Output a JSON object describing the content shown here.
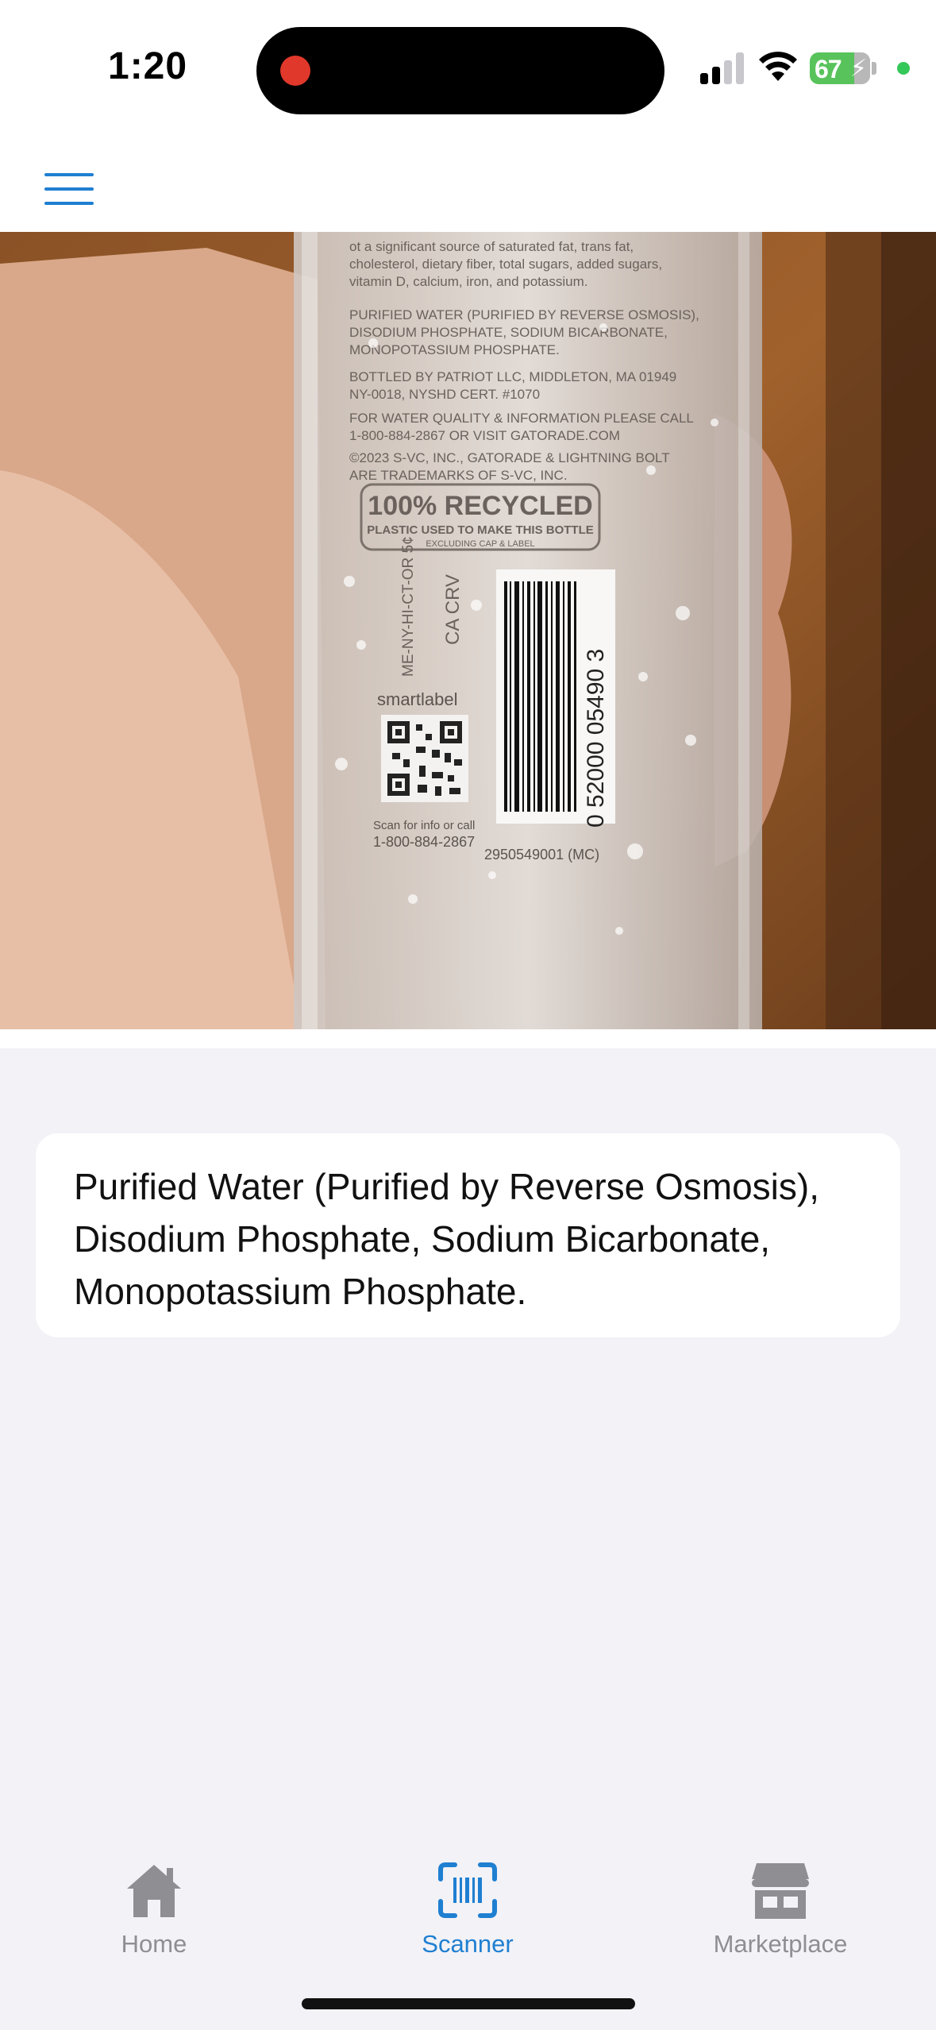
{
  "status_bar": {
    "time": "1:20",
    "battery_level": "67",
    "recording_indicator": "recording-dot",
    "signal_bars": 2,
    "signal_total": 4
  },
  "nav": {
    "menu_icon": "hamburger-menu-icon",
    "accent_color": "#1f7fd1"
  },
  "scan_image": {
    "label_lines": [
      "ot a significant source of saturated fat, trans fat,",
      "cholesterol, dietary fiber, total sugars, added sugars,",
      "vitamin D, calcium, iron, and potassium.",
      "PURIFIED WATER (PURIFIED BY REVERSE OSMOSIS),",
      "DISODIUM PHOSPHATE, SODIUM BICARBONATE,",
      "MONOPOTASSIUM PHOSPHATE.",
      "BOTTLED BY PATRIOT LLC, MIDDLETON, MA 01949",
      "NY-0018, NYSHD CERT. #1070",
      "FOR WATER QUALITY & INFORMATION PLEASE CALL",
      "1-800-884-2867 OR VISIT GATORADE.COM",
      "©2023 S-VC, INC., GATORADE & LIGHTNING BOLT",
      "ARE TRADEMARKS OF S-VC, INC."
    ],
    "recycled_title": "100% RECYCLED",
    "recycled_sub": "PLASTIC USED TO MAKE THIS BOTTLE",
    "recycled_excl": "EXCLUDING CAP & LABEL",
    "deposit_line1": "ME-NY-HI-CT-OR 5¢",
    "deposit_line2": "CA CRV",
    "smartlabel": "smartlabel",
    "scan_line1": "Scan for info or call",
    "scan_line2": "1-800-884-2867",
    "barcode_number": "0   52000 05490   3",
    "batch_code": "2950549001 (MC)"
  },
  "result": {
    "ingredients": "Purified Water (Purified by Reverse Osmosis), Disodium Phosphate, Sodium Bicarbonate, Monopotassium Phosphate."
  },
  "tabs": [
    {
      "label": "Home",
      "icon": "home-icon",
      "active": false
    },
    {
      "label": "Scanner",
      "icon": "barcode-scanner-icon",
      "active": true
    },
    {
      "label": "Marketplace",
      "icon": "storefront-icon",
      "active": false
    }
  ],
  "colors": {
    "tab_active": "#1f7fd1",
    "tab_inactive": "#8e8e93",
    "background": "#f2f2f7"
  }
}
